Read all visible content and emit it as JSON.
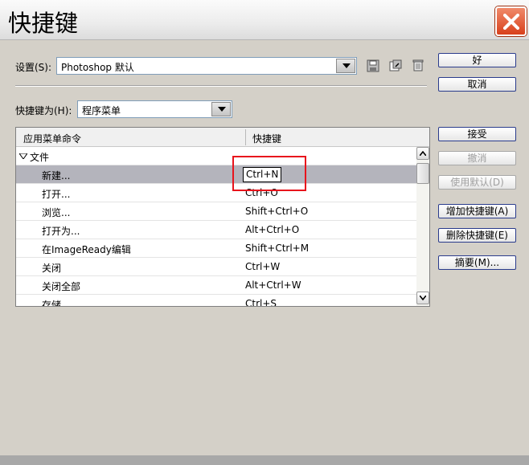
{
  "window": {
    "title": "快捷键"
  },
  "settings": {
    "label": "设置(S):",
    "value": "Photoshop 默认"
  },
  "shortcuts_for": {
    "label": "快捷键为(H):",
    "value": "程序菜单"
  },
  "table": {
    "col_command": "应用菜单命令",
    "col_shortcut": "快捷键",
    "rows": [
      {
        "command": "文件",
        "shortcut": "",
        "group": true
      },
      {
        "command": "新建...",
        "shortcut": "Ctrl+N",
        "selected": true
      },
      {
        "command": "打开...",
        "shortcut": "Ctrl+O"
      },
      {
        "command": "浏览...",
        "shortcut": "Shift+Ctrl+O"
      },
      {
        "command": "打开为...",
        "shortcut": "Alt+Ctrl+O"
      },
      {
        "command": "在ImageReady编辑",
        "shortcut": "Shift+Ctrl+M"
      },
      {
        "command": "关闭",
        "shortcut": "Ctrl+W"
      },
      {
        "command": "关闭全部",
        "shortcut": "Alt+Ctrl+W"
      },
      {
        "command": "存储",
        "shortcut": "Ctrl+S"
      }
    ]
  },
  "buttons": {
    "ok": "好",
    "cancel": "取消",
    "accept": "接受",
    "undo": "撤消",
    "use_default": "使用默认(D)",
    "add_shortcut": "增加快捷键(A)",
    "delete_shortcut": "删除快捷键(E)",
    "summary": "摘要(M)..."
  },
  "icons": {
    "close": "close-icon",
    "save": "save-icon",
    "save_as": "save-as-icon",
    "delete": "trash-icon"
  },
  "colors": {
    "close_button": "#d8401c",
    "highlight": "#e8141c"
  }
}
